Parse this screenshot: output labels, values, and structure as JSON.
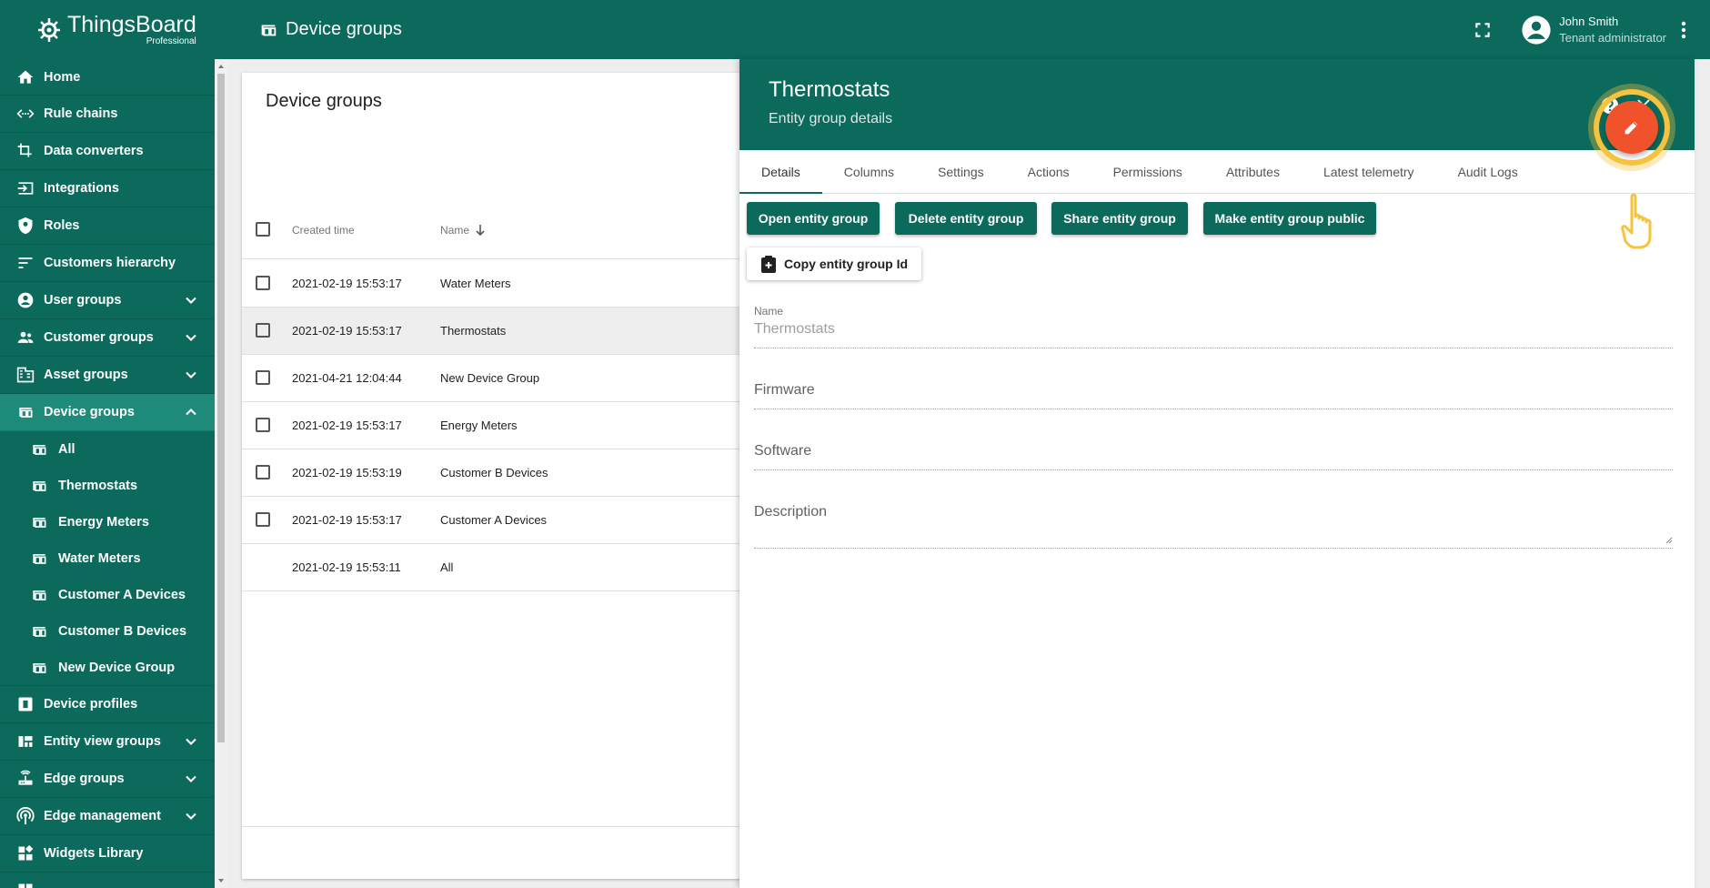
{
  "logo": {
    "name": "ThingsBoard",
    "edition": "Professional"
  },
  "topbar": {
    "title": "Device groups",
    "user_name": "John Smith",
    "user_role": "Tenant administrator"
  },
  "sidebar": {
    "items": [
      {
        "label": "Home",
        "icon": "home-icon"
      },
      {
        "label": "Rule chains",
        "icon": "rule-chain-icon"
      },
      {
        "label": "Data converters",
        "icon": "transform-icon"
      },
      {
        "label": "Integrations",
        "icon": "input-icon"
      },
      {
        "label": "Roles",
        "icon": "shield-icon"
      },
      {
        "label": "Customers hierarchy",
        "icon": "sort-icon"
      },
      {
        "label": "User groups",
        "icon": "account-icon",
        "expandable": true
      },
      {
        "label": "Customer groups",
        "icon": "supervisor-icon",
        "expandable": true
      },
      {
        "label": "Asset groups",
        "icon": "domain-icon",
        "expandable": true
      },
      {
        "label": "Device groups",
        "icon": "devices-icon",
        "expandable": true,
        "active": true
      }
    ],
    "subitems": [
      "All",
      "Thermostats",
      "Energy Meters",
      "Water Meters",
      "Customer A Devices",
      "Customer B Devices",
      "New Device Group"
    ],
    "items_after": [
      {
        "label": "Device profiles",
        "icon": "device-profile-icon"
      },
      {
        "label": "Entity view groups",
        "icon": "view-quilt-icon",
        "expandable": true
      },
      {
        "label": "Edge groups",
        "icon": "router-icon",
        "expandable": true
      },
      {
        "label": "Edge management",
        "icon": "settings-input-antenna-icon",
        "expandable": true
      },
      {
        "label": "Widgets Library",
        "icon": "widgets-icon"
      }
    ]
  },
  "table": {
    "title": "Device groups",
    "columns": {
      "created": "Created time",
      "name": "Name"
    },
    "rows": [
      {
        "created": "2021-02-19 15:53:17",
        "name": "Water Meters",
        "checkbox": true,
        "selected": false
      },
      {
        "created": "2021-02-19 15:53:17",
        "name": "Thermostats",
        "checkbox": true,
        "selected": true
      },
      {
        "created": "2021-04-21 12:04:44",
        "name": "New Device Group",
        "checkbox": true,
        "selected": false
      },
      {
        "created": "2021-02-19 15:53:17",
        "name": "Energy Meters",
        "checkbox": true,
        "selected": false
      },
      {
        "created": "2021-02-19 15:53:19",
        "name": "Customer B Devices",
        "checkbox": true,
        "selected": false
      },
      {
        "created": "2021-02-19 15:53:17",
        "name": "Customer A Devices",
        "checkbox": true,
        "selected": false
      },
      {
        "created": "2021-02-19 15:53:11",
        "name": "All",
        "checkbox": false,
        "selected": false
      }
    ]
  },
  "details": {
    "title": "Thermostats",
    "subtitle": "Entity group details",
    "tabs": [
      "Details",
      "Columns",
      "Settings",
      "Actions",
      "Permissions",
      "Attributes",
      "Latest telemetry",
      "Audit Logs"
    ],
    "active_tab": "Details",
    "buttons": {
      "open": "Open entity group",
      "delete": "Delete entity group",
      "share": "Share entity group",
      "make_public": "Make entity group public",
      "copy_id": "Copy entity group Id"
    },
    "fields": {
      "name_label": "Name",
      "name_value": "Thermostats",
      "firmware_placeholder": "Firmware",
      "software_placeholder": "Software",
      "description_placeholder": "Description"
    }
  },
  "colors": {
    "primary": "#0b6a5c",
    "accent": "#f0532b",
    "highlight": "#f5c33d"
  }
}
